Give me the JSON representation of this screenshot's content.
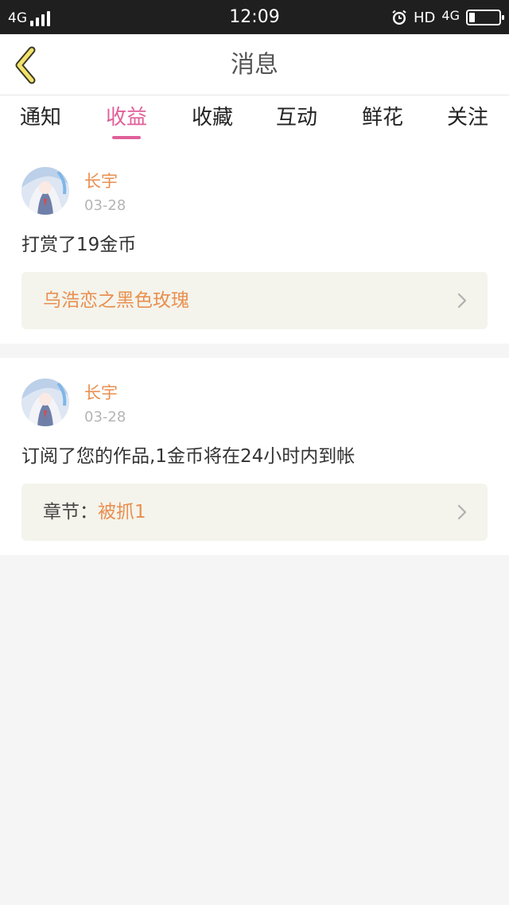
{
  "status_bar": {
    "network": "4G",
    "time": "12:09",
    "hd": "HD",
    "network_right": "4G",
    "battery_level": 0.2
  },
  "header": {
    "title": "消息"
  },
  "tabs": [
    {
      "label": "通知"
    },
    {
      "label": "收益",
      "active": true
    },
    {
      "label": "收藏"
    },
    {
      "label": "互动"
    },
    {
      "label": "鲜花"
    },
    {
      "label": "关注"
    }
  ],
  "messages": [
    {
      "user": "长宇",
      "date": "03-28",
      "text": "打赏了19金币",
      "link": {
        "label": "",
        "value": "乌浩恋之黑色玫瑰"
      }
    },
    {
      "user": "长宇",
      "date": "03-28",
      "text": "订阅了您的作品,1金币将在24小时内到帐",
      "link": {
        "label": "章节：",
        "value": "被抓1"
      }
    }
  ],
  "colors": {
    "accent": "#e0609a",
    "username": "#e98f4f",
    "status_bar": "#1f1f1f",
    "back_arrow": "#f3e36a",
    "link_box": "#f4f4ec"
  },
  "icons": {
    "back": "back-arrow-icon",
    "alarm": "alarm-clock-icon",
    "chevron": "chevron-right-icon"
  }
}
